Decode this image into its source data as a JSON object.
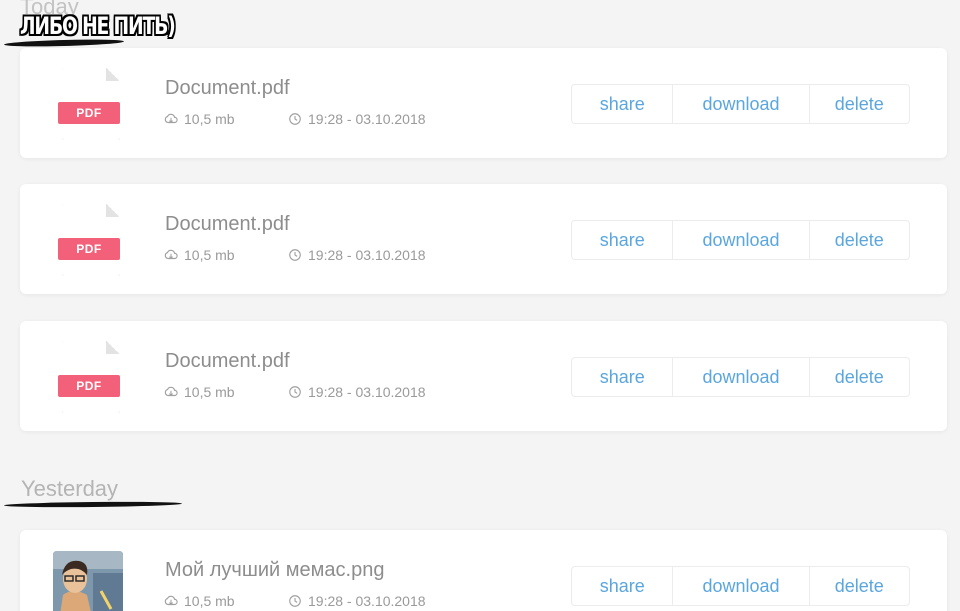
{
  "meme_caption": "ЛИБО НЕ ПИТЬ)",
  "sections": {
    "today_title": "Today",
    "yesterday_title": "Yesterday"
  },
  "files": [
    {
      "name": "Document.pdf",
      "type_label": "PDF",
      "size": "10,5 mb",
      "datetime": "19:28 - 03.10.2018"
    },
    {
      "name": "Document.pdf",
      "type_label": "PDF",
      "size": "10,5 mb",
      "datetime": "19:28 - 03.10.2018"
    },
    {
      "name": "Document.pdf",
      "type_label": "PDF",
      "size": "10,5 mb",
      "datetime": "19:28 - 03.10.2018"
    },
    {
      "name": "Мой лучший мемас.png",
      "size": "10,5 mb",
      "datetime": "19:28 - 03.10.2018"
    }
  ],
  "actions": {
    "share": "share",
    "download": "download",
    "delete": "delete"
  },
  "colors": {
    "accent": "#5aa6df",
    "pdf_badge": "#f2607a",
    "text_muted": "#8d8d8d",
    "background": "#f4f4f4"
  },
  "icons": {
    "size": "cloud-icon",
    "date": "clock-icon",
    "file": "pdf-file-icon"
  }
}
